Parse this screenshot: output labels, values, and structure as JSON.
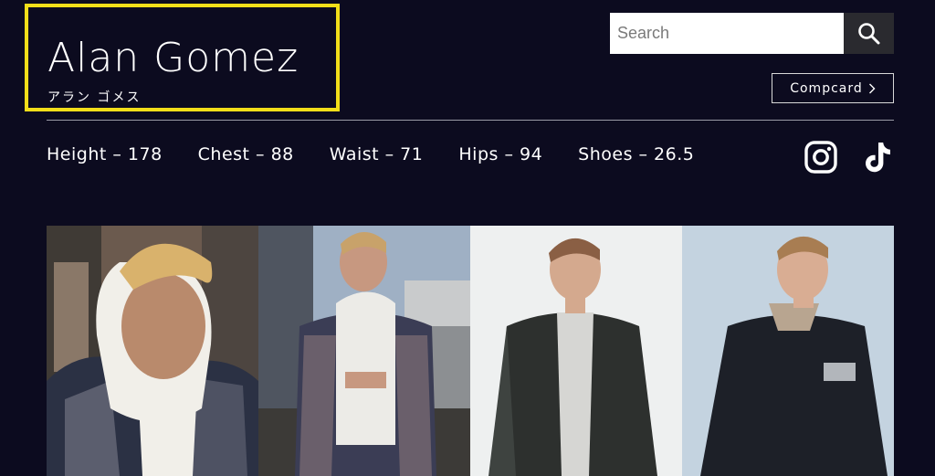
{
  "model": {
    "name": "Alan Gomez",
    "name_kana": "アラン ゴメス"
  },
  "search": {
    "placeholder": "Search",
    "value": ""
  },
  "compcard": {
    "label": "Compcard",
    "icon": "chevron-right-icon"
  },
  "measurements": [
    {
      "label": "Height",
      "value": "178",
      "text": "Height – 178"
    },
    {
      "label": "Chest",
      "value": "88",
      "text": "Chest – 88"
    },
    {
      "label": "Waist",
      "value": "71",
      "text": "Waist – 71"
    },
    {
      "label": "Hips",
      "value": "94",
      "text": "Hips – 94"
    },
    {
      "label": "Shoes",
      "value": "26.5",
      "text": "Shoes – 26.5"
    }
  ],
  "social": [
    "instagram-icon",
    "tiktok-icon"
  ],
  "colors": {
    "background": "#0c0b1f",
    "highlight_border": "#f2de19",
    "text": "#ffffff"
  },
  "gallery": [
    "photo-blond-hoodie-plaid-closeup",
    "photo-hoodie-plaid-shirt-city",
    "photo-leather-jacket-white-bg",
    "photo-black-shirt-blue-bg"
  ]
}
